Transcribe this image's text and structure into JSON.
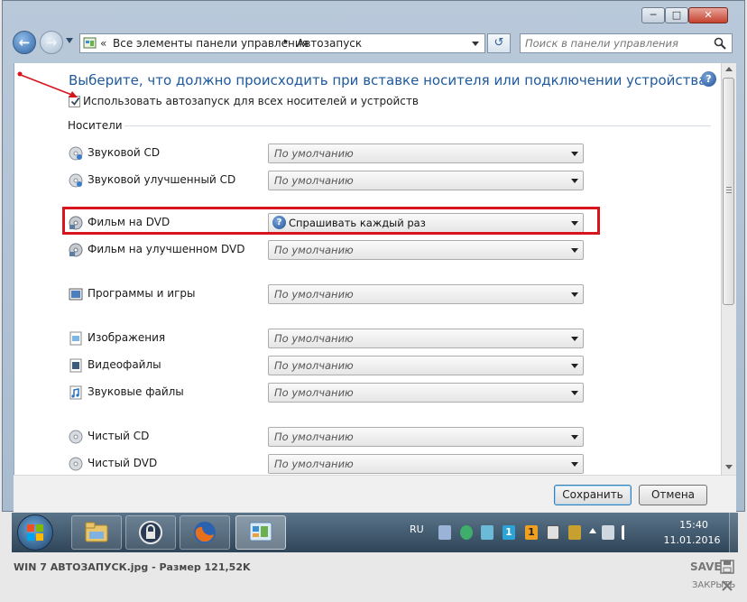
{
  "window": {
    "minimize": "─",
    "maximize": "□",
    "close": "✕"
  },
  "nav": {
    "back_icon": "arrow-left-icon",
    "forward_icon": "arrow-right-icon",
    "address_prefix": "«",
    "address_path": "Все элементы панели управления",
    "address_sep": "▸",
    "address_current": "Автозапуск",
    "search_placeholder": "Поиск в панели управления"
  },
  "main": {
    "heading": "Выберите, что должно происходить при вставке носителя или подключении устройства",
    "autoplay_checkbox_label": "Использовать автозапуск для всех носителей и устройств",
    "autoplay_checked": true,
    "section_media": "Носители",
    "help_icon": "?",
    "items": [
      {
        "label": "Звуковой CD",
        "value": "По умолчанию",
        "icon": "audio-cd-icon"
      },
      {
        "label": "Звуковой улучшенный CD",
        "value": "По умолчанию",
        "icon": "enhanced-cd-icon"
      },
      {
        "label": "Фильм на DVD",
        "value": "Спрашивать каждый раз",
        "icon": "dvd-icon",
        "highlighted": true
      },
      {
        "label": "Фильм на улучшенном DVD",
        "value": "По умолчанию",
        "icon": "enhanced-dvd-icon"
      },
      {
        "label": "Программы и игры",
        "value": "По умолчанию",
        "icon": "programs-icon"
      },
      {
        "label": "Изображения",
        "value": "По умолчанию",
        "icon": "images-icon"
      },
      {
        "label": "Видеофайлы",
        "value": "По умолчанию",
        "icon": "video-files-icon"
      },
      {
        "label": "Звуковые файлы",
        "value": "По умолчанию",
        "icon": "audio-files-icon"
      },
      {
        "label": "Чистый CD",
        "value": "По умолчанию",
        "icon": "blank-cd-icon"
      },
      {
        "label": "Чистый DVD",
        "value": "По умолчанию",
        "icon": "blank-dvd-icon"
      }
    ]
  },
  "footer": {
    "save": "Сохранить",
    "cancel": "Отмена"
  },
  "taskbar": {
    "lang": "RU",
    "time": "15:40",
    "date": "11.01.2016",
    "tray_badge": "1"
  },
  "viewer": {
    "filename": "WIN 7 АВТОЗАПУСК.jpg - Размер 121,52K",
    "save": "SAVE",
    "close": "ЗАКРЫТЬ"
  },
  "colors": {
    "heading": "#1e5aa0",
    "annotation_red": "#d8141c"
  }
}
